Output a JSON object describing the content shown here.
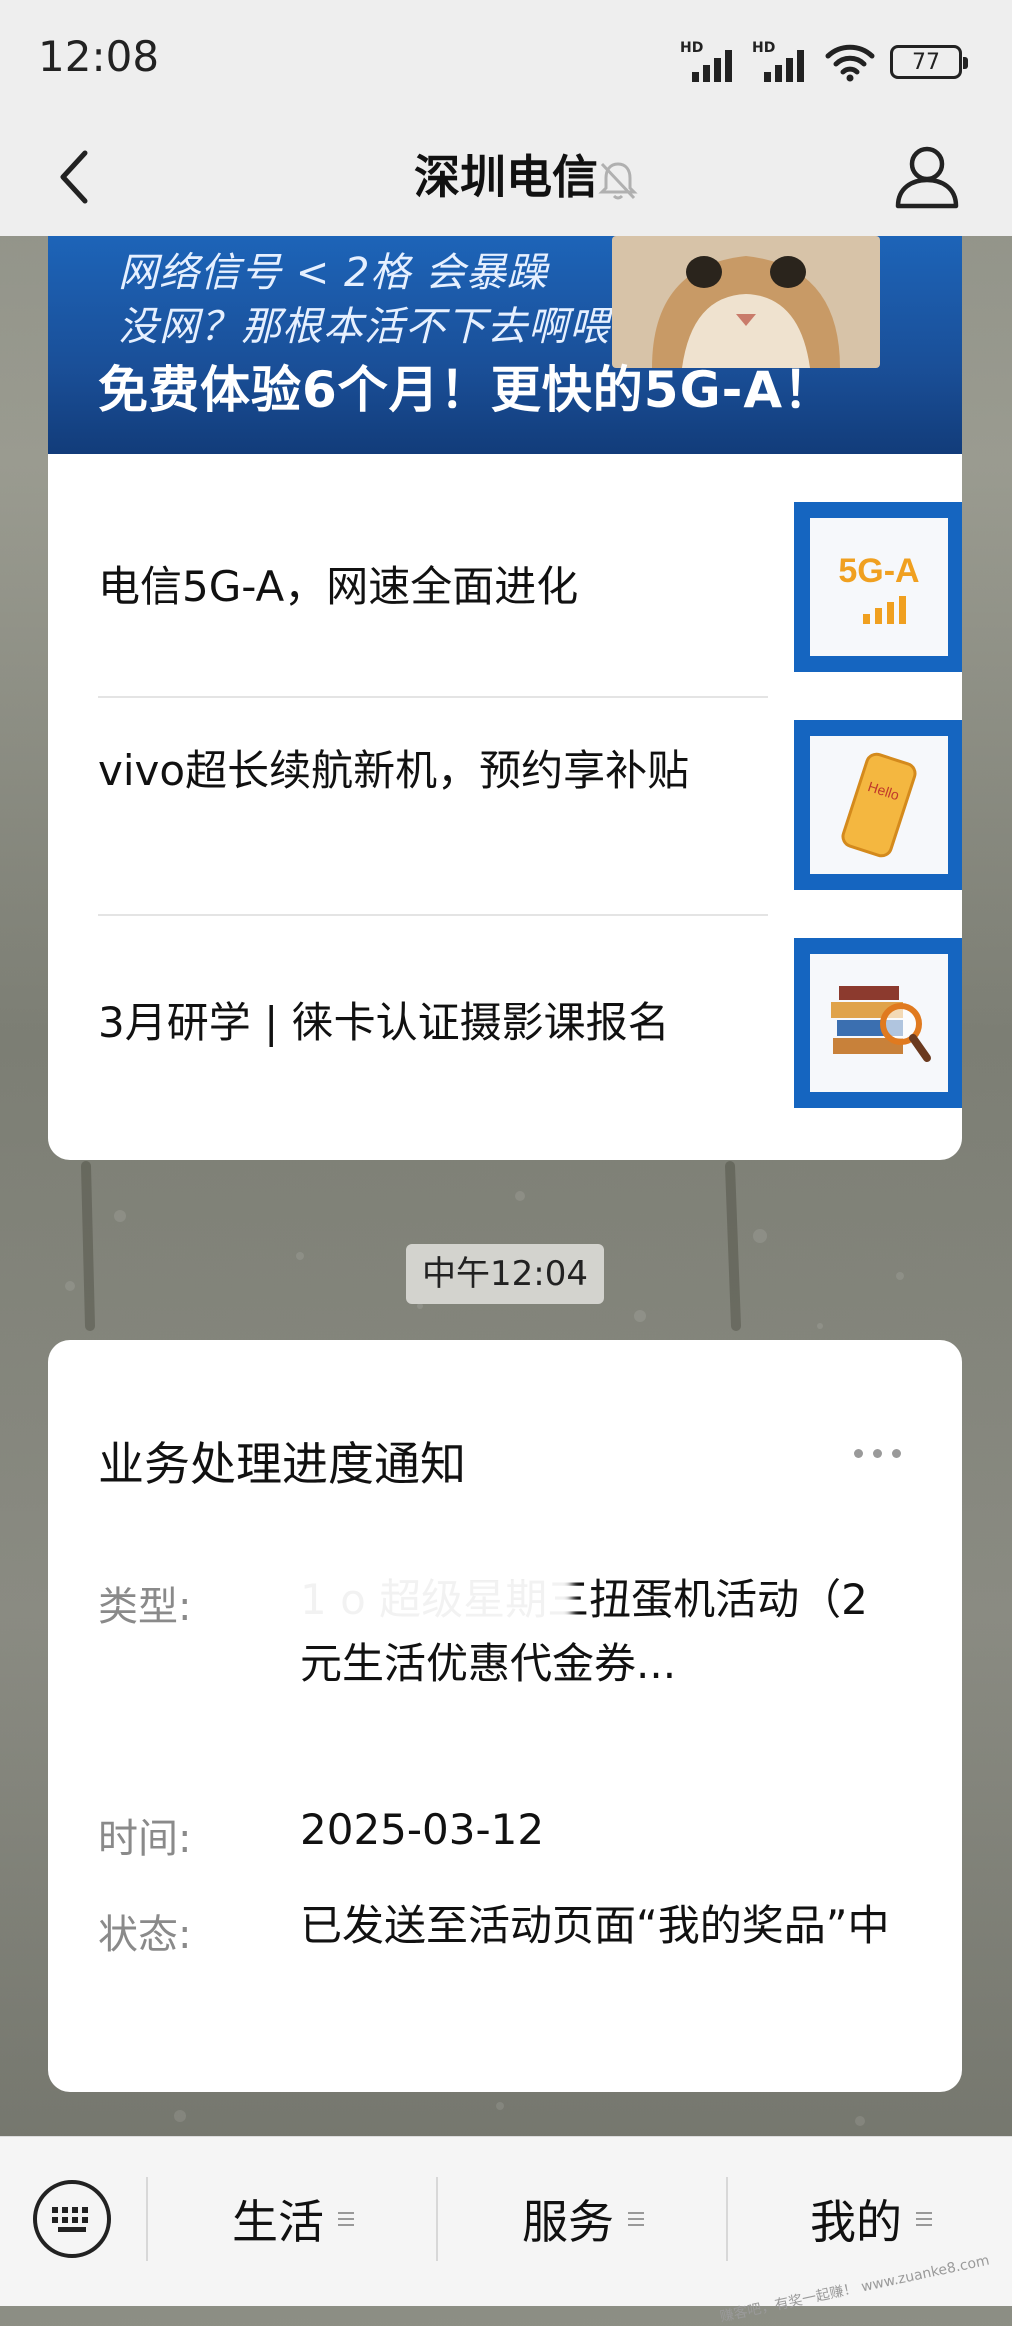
{
  "status_bar": {
    "time": "12:08",
    "sim1": "HD",
    "sim2": "HD",
    "battery": "77"
  },
  "nav": {
    "title": "深圳电信"
  },
  "banner": {
    "line1": "网络信号 < 2格 会暴躁",
    "line2": "没网？那根本活不下去啊喂",
    "cta": "免费体验6个月！更快的5G-A！"
  },
  "news": [
    {
      "title": "电信5G-A，网速全面进化",
      "thumb": "5g-a-thumbnail",
      "thumb_text": "5G-A"
    },
    {
      "title": "vivo超长续航新机，预约享补贴",
      "thumb": "phone-thumbnail",
      "thumb_text": "Hello"
    },
    {
      "title": "3月研学 | 徕卡认证摄影课报名",
      "thumb": "books-magnifier-thumbnail"
    }
  ],
  "time_divider": "中午12:04",
  "notice": {
    "title": "业务处理进度通知",
    "rows": [
      {
        "label": "类型:",
        "value": "1               o   超级星期三扭蛋机活动（2元生活优惠代金券..."
      },
      {
        "label": "时间:",
        "value": "2025-03-12"
      },
      {
        "label": "状态:",
        "value": "已发送至活动页面“我的奖品”中"
      }
    ]
  },
  "tabbar": {
    "tabs": [
      {
        "label": "生活"
      },
      {
        "label": "服务"
      },
      {
        "label": "我的"
      }
    ]
  },
  "watermark": "赚客吧，有奖一起赚！ www.zuanke8.com",
  "colors": {
    "banner_blue": "#1a4f98",
    "thumb_blue": "#1565c0",
    "nav_bg": "#eeeeee"
  }
}
